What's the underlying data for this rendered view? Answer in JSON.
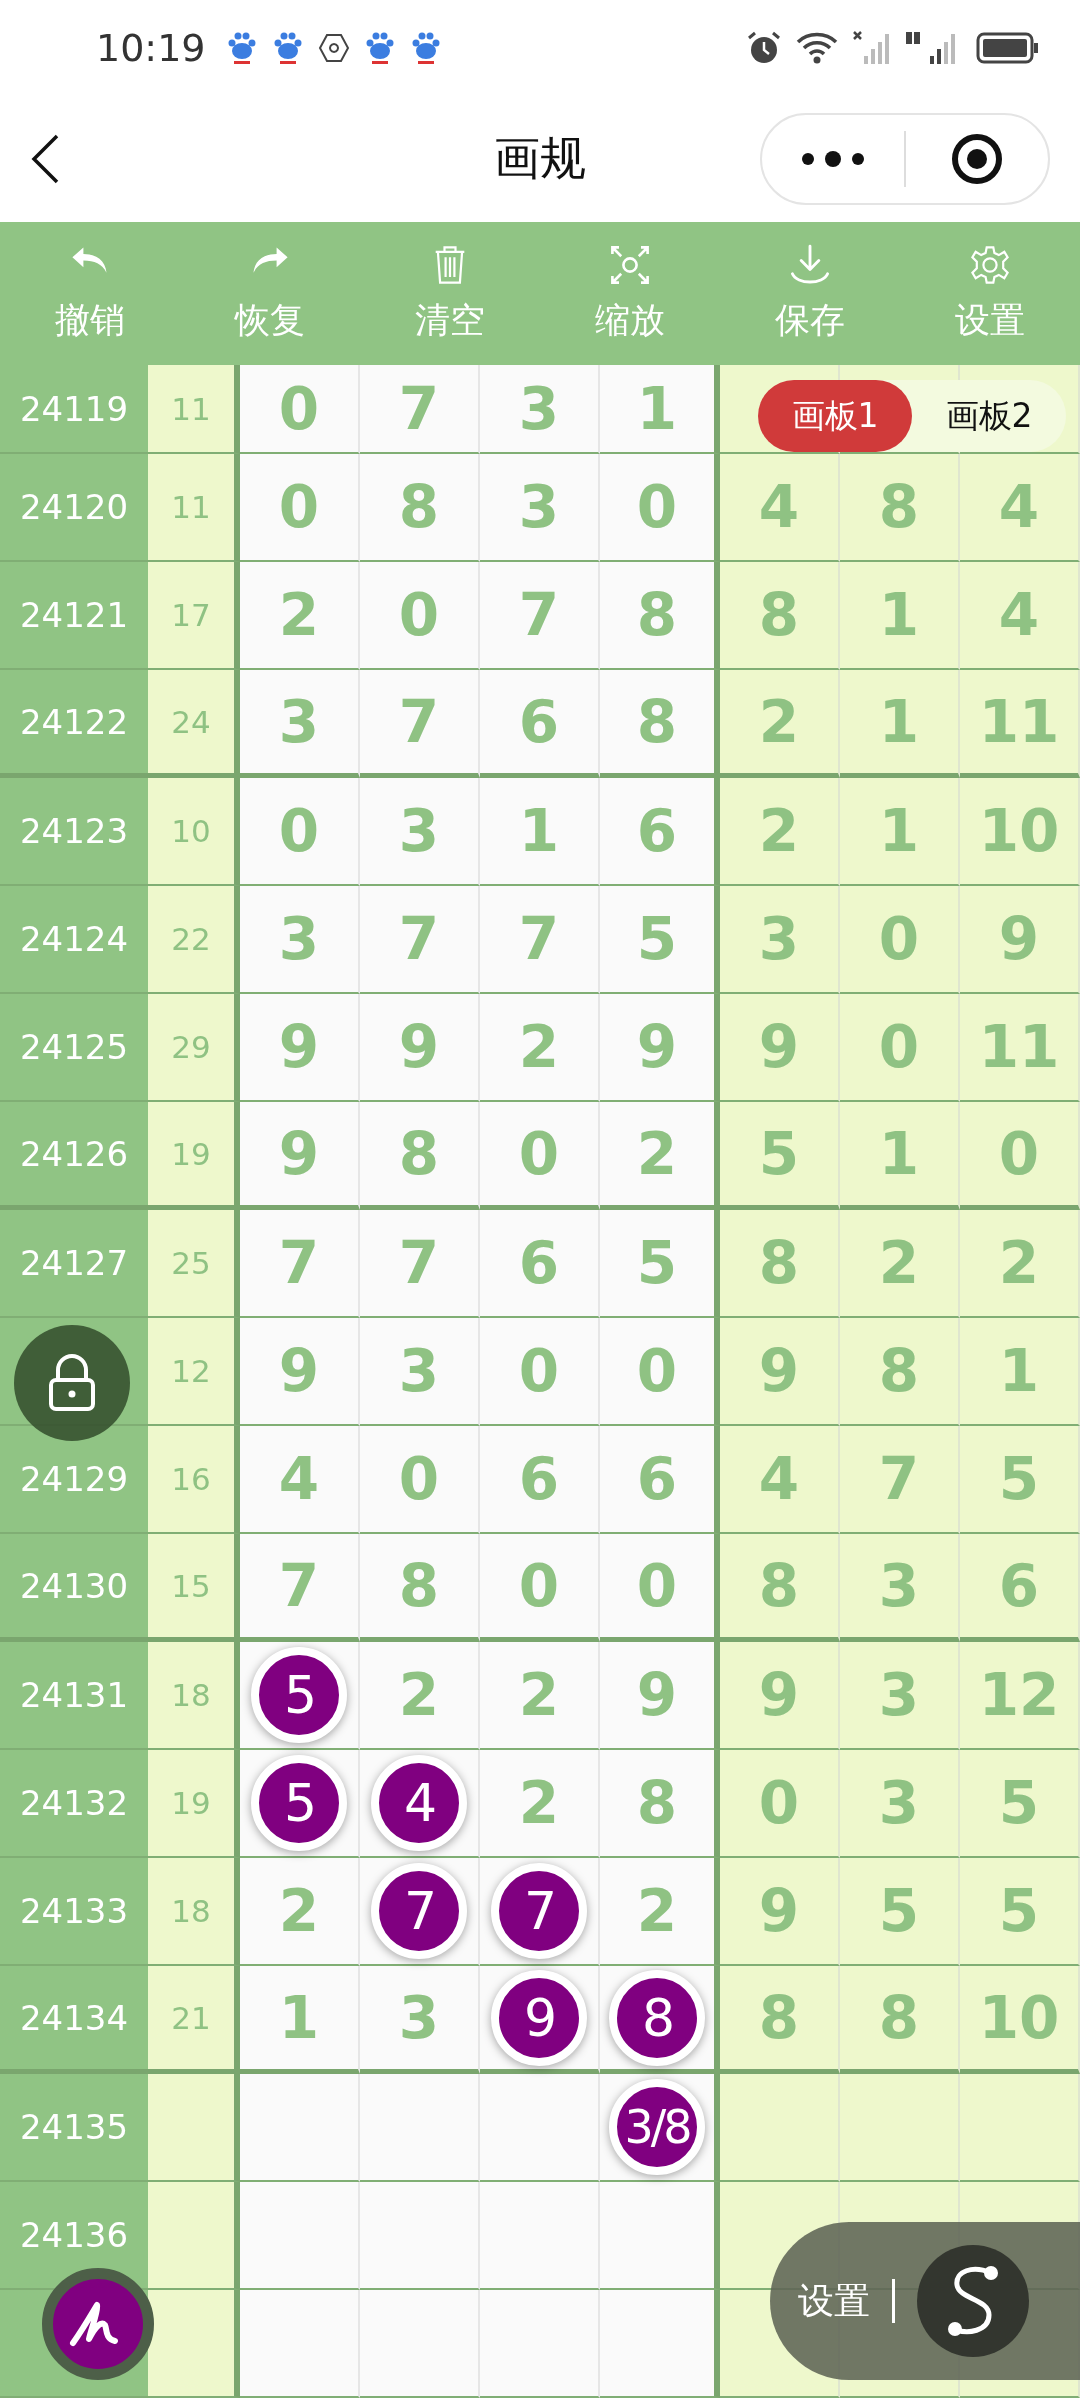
{
  "status_bar": {
    "time": "10:19"
  },
  "header": {
    "title": "画规"
  },
  "toolbar": [
    {
      "kind": "undo",
      "label": "撤销"
    },
    {
      "kind": "redo",
      "label": "恢复"
    },
    {
      "kind": "clear",
      "label": "清空"
    },
    {
      "kind": "zoom",
      "label": "缩放"
    },
    {
      "kind": "save",
      "label": "保存"
    },
    {
      "kind": "settings",
      "label": "设置"
    }
  ],
  "board_tabs": [
    {
      "label": "画板1",
      "selected": true
    },
    {
      "label": "画板2",
      "selected": false
    }
  ],
  "rows": [
    {
      "issue": "24119",
      "sum": "11",
      "cells": [
        {
          "value": "0",
          "circled": false
        },
        {
          "value": "7",
          "circled": false
        },
        {
          "value": "3",
          "circled": false
        },
        {
          "value": "1",
          "circled": false
        }
      ]
    },
    {
      "issue": "24120",
      "sum": "11",
      "cells": [
        {
          "value": "0",
          "circled": false
        },
        {
          "value": "8",
          "circled": false
        },
        {
          "value": "3",
          "circled": false
        },
        {
          "value": "0",
          "circled": false
        },
        {
          "value": "4",
          "circled": false
        },
        {
          "value": "8",
          "circled": false
        },
        {
          "value": "4",
          "circled": false
        }
      ]
    },
    {
      "issue": "24121",
      "sum": "17",
      "cells": [
        {
          "value": "2",
          "circled": false
        },
        {
          "value": "0",
          "circled": false
        },
        {
          "value": "7",
          "circled": false
        },
        {
          "value": "8",
          "circled": false
        },
        {
          "value": "8",
          "circled": false
        },
        {
          "value": "1",
          "circled": false
        },
        {
          "value": "4",
          "circled": false
        }
      ]
    },
    {
      "issue": "24122",
      "sum": "24",
      "cells": [
        {
          "value": "3",
          "circled": false
        },
        {
          "value": "7",
          "circled": false
        },
        {
          "value": "6",
          "circled": false
        },
        {
          "value": "8",
          "circled": false
        },
        {
          "value": "2",
          "circled": false
        },
        {
          "value": "1",
          "circled": false
        },
        {
          "value": "11",
          "circled": false
        }
      ]
    },
    {
      "issue": "24123",
      "sum": "10",
      "cells": [
        {
          "value": "0",
          "circled": false
        },
        {
          "value": "3",
          "circled": false
        },
        {
          "value": "1",
          "circled": false
        },
        {
          "value": "6",
          "circled": false
        },
        {
          "value": "2",
          "circled": false
        },
        {
          "value": "1",
          "circled": false
        },
        {
          "value": "10",
          "circled": false
        }
      ]
    },
    {
      "issue": "24124",
      "sum": "22",
      "cells": [
        {
          "value": "3",
          "circled": false
        },
        {
          "value": "7",
          "circled": false
        },
        {
          "value": "7",
          "circled": false
        },
        {
          "value": "5",
          "circled": false
        },
        {
          "value": "3",
          "circled": false
        },
        {
          "value": "0",
          "circled": false
        },
        {
          "value": "9",
          "circled": false
        }
      ]
    },
    {
      "issue": "24125",
      "sum": "29",
      "cells": [
        {
          "value": "9",
          "circled": false
        },
        {
          "value": "9",
          "circled": false
        },
        {
          "value": "2",
          "circled": false
        },
        {
          "value": "9",
          "circled": false
        },
        {
          "value": "9",
          "circled": false
        },
        {
          "value": "0",
          "circled": false
        },
        {
          "value": "11",
          "circled": false
        }
      ]
    },
    {
      "issue": "24126",
      "sum": "19",
      "cells": [
        {
          "value": "9",
          "circled": false
        },
        {
          "value": "8",
          "circled": false
        },
        {
          "value": "0",
          "circled": false
        },
        {
          "value": "2",
          "circled": false
        },
        {
          "value": "5",
          "circled": false
        },
        {
          "value": "1",
          "circled": false
        },
        {
          "value": "0",
          "circled": false
        }
      ]
    },
    {
      "issue": "24127",
      "sum": "25",
      "cells": [
        {
          "value": "7",
          "circled": false
        },
        {
          "value": "7",
          "circled": false
        },
        {
          "value": "6",
          "circled": false
        },
        {
          "value": "5",
          "circled": false
        },
        {
          "value": "8",
          "circled": false
        },
        {
          "value": "2",
          "circled": false
        },
        {
          "value": "2",
          "circled": false
        }
      ]
    },
    {
      "sum": "12",
      "cells": [
        {
          "value": "9",
          "circled": false
        },
        {
          "value": "3",
          "circled": false
        },
        {
          "value": "0",
          "circled": false
        },
        {
          "value": "0",
          "circled": false
        },
        {
          "value": "9",
          "circled": false
        },
        {
          "value": "8",
          "circled": false
        },
        {
          "value": "1",
          "circled": false
        }
      ]
    },
    {
      "issue": "24129",
      "sum": "16",
      "cells": [
        {
          "value": "4",
          "circled": false
        },
        {
          "value": "0",
          "circled": false
        },
        {
          "value": "6",
          "circled": false
        },
        {
          "value": "6",
          "circled": false
        },
        {
          "value": "4",
          "circled": false
        },
        {
          "value": "7",
          "circled": false
        },
        {
          "value": "5",
          "circled": false
        }
      ]
    },
    {
      "issue": "24130",
      "sum": "15",
      "cells": [
        {
          "value": "7",
          "circled": false
        },
        {
          "value": "8",
          "circled": false
        },
        {
          "value": "0",
          "circled": false
        },
        {
          "value": "0",
          "circled": false
        },
        {
          "value": "8",
          "circled": false
        },
        {
          "value": "3",
          "circled": false
        },
        {
          "value": "6",
          "circled": false
        }
      ]
    },
    {
      "issue": "24131",
      "sum": "18",
      "cells": [
        {
          "value": "5",
          "circled": true
        },
        {
          "value": "2",
          "circled": false
        },
        {
          "value": "2",
          "circled": false
        },
        {
          "value": "9",
          "circled": false
        },
        {
          "value": "9",
          "circled": false
        },
        {
          "value": "3",
          "circled": false
        },
        {
          "value": "12",
          "circled": false
        }
      ]
    },
    {
      "issue": "24132",
      "sum": "19",
      "cells": [
        {
          "value": "5",
          "circled": true
        },
        {
          "value": "4",
          "circled": true
        },
        {
          "value": "2",
          "circled": false
        },
        {
          "value": "8",
          "circled": false
        },
        {
          "value": "0",
          "circled": false
        },
        {
          "value": "3",
          "circled": false
        },
        {
          "value": "5",
          "circled": false
        }
      ]
    },
    {
      "issue": "24133",
      "sum": "18",
      "cells": [
        {
          "value": "2",
          "circled": false
        },
        {
          "value": "7",
          "circled": true
        },
        {
          "value": "7",
          "circled": true
        },
        {
          "value": "2",
          "circled": false
        },
        {
          "value": "9",
          "circled": false
        },
        {
          "value": "5",
          "circled": false
        },
        {
          "value": "5",
          "circled": false
        }
      ]
    },
    {
      "issue": "24134",
      "sum": "21",
      "cells": [
        {
          "value": "1",
          "circled": false
        },
        {
          "value": "3",
          "circled": false
        },
        {
          "value": "9",
          "circled": true
        },
        {
          "value": "8",
          "circled": true
        },
        {
          "value": "8",
          "circled": false
        },
        {
          "value": "8",
          "circled": false
        },
        {
          "value": "10",
          "circled": false
        }
      ]
    },
    {
      "issue": "24135",
      "cells": [
        null,
        null,
        null,
        {
          "value": "3/8",
          "circled": true
        }
      ]
    },
    {
      "issue": "24136"
    },
    {}
  ],
  "float_menu": {
    "label": "设置"
  }
}
